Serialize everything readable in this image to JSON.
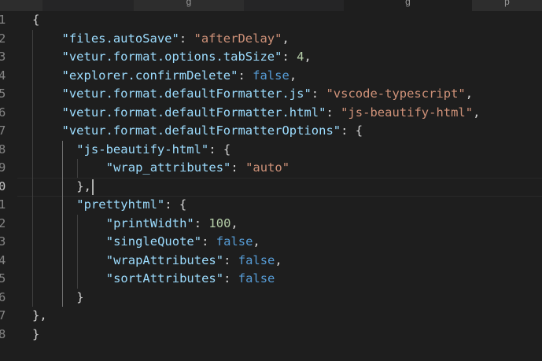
{
  "tabs": [
    {
      "label": "",
      "active": false
    },
    {
      "label": "g",
      "active": false
    },
    {
      "label": "g",
      "active": true
    },
    {
      "label": "p",
      "active": false
    }
  ],
  "gutter": {
    "line_numbers": [
      "1",
      "2",
      "3",
      "4",
      "5",
      "6",
      "7",
      "8",
      "9",
      "0",
      "1",
      "2",
      "3",
      "4",
      "5",
      "6",
      "7",
      "8"
    ],
    "active_line_index": 9
  },
  "code_lines": [
    {
      "indent": 0,
      "tokens": [
        {
          "t": "p",
          "v": "{"
        }
      ]
    },
    {
      "indent": 1,
      "tokens": [
        {
          "t": "k",
          "v": "\"files.autoSave\""
        },
        {
          "t": "p",
          "v": ": "
        },
        {
          "t": "s",
          "v": "\"afterDelay\""
        },
        {
          "t": "p",
          "v": ","
        }
      ]
    },
    {
      "indent": 1,
      "tokens": [
        {
          "t": "k",
          "v": "\"vetur.format.options.tabSize\""
        },
        {
          "t": "p",
          "v": ": "
        },
        {
          "t": "n",
          "v": "4"
        },
        {
          "t": "p",
          "v": ","
        }
      ]
    },
    {
      "indent": 1,
      "tokens": [
        {
          "t": "k",
          "v": "\"explorer.confirmDelete\""
        },
        {
          "t": "p",
          "v": ": "
        },
        {
          "t": "b",
          "v": "false"
        },
        {
          "t": "p",
          "v": ","
        }
      ]
    },
    {
      "indent": 1,
      "tokens": [
        {
          "t": "k",
          "v": "\"vetur.format.defaultFormatter.js\""
        },
        {
          "t": "p",
          "v": ": "
        },
        {
          "t": "s",
          "v": "\"vscode-typescript\""
        },
        {
          "t": "p",
          "v": ","
        }
      ]
    },
    {
      "indent": 1,
      "tokens": [
        {
          "t": "k",
          "v": "\"vetur.format.defaultFormatter.html\""
        },
        {
          "t": "p",
          "v": ": "
        },
        {
          "t": "s",
          "v": "\"js-beautify-html\""
        },
        {
          "t": "p",
          "v": ","
        }
      ]
    },
    {
      "indent": 1,
      "tokens": [
        {
          "t": "k",
          "v": "\"vetur.format.defaultFormatterOptions\""
        },
        {
          "t": "p",
          "v": ": {"
        }
      ]
    },
    {
      "indent": 1.5,
      "tokens": [
        {
          "t": "k",
          "v": "\"js-beautify-html\""
        },
        {
          "t": "p",
          "v": ": {"
        }
      ]
    },
    {
      "indent": 2.5,
      "tokens": [
        {
          "t": "k",
          "v": "\"wrap_attributes\""
        },
        {
          "t": "p",
          "v": ": "
        },
        {
          "t": "s",
          "v": "\"auto\""
        }
      ]
    },
    {
      "indent": 1.5,
      "tokens": [
        {
          "t": "p",
          "v": "},"
        }
      ]
    },
    {
      "indent": 1.5,
      "tokens": [
        {
          "t": "k",
          "v": "\"prettyhtml\""
        },
        {
          "t": "p",
          "v": ": {"
        }
      ]
    },
    {
      "indent": 2.5,
      "tokens": [
        {
          "t": "k",
          "v": "\"printWidth\""
        },
        {
          "t": "p",
          "v": ": "
        },
        {
          "t": "n",
          "v": "100"
        },
        {
          "t": "p",
          "v": ","
        }
      ]
    },
    {
      "indent": 2.5,
      "tokens": [
        {
          "t": "k",
          "v": "\"singleQuote\""
        },
        {
          "t": "p",
          "v": ": "
        },
        {
          "t": "b",
          "v": "false"
        },
        {
          "t": "p",
          "v": ","
        }
      ]
    },
    {
      "indent": 2.5,
      "tokens": [
        {
          "t": "k",
          "v": "\"wrapAttributes\""
        },
        {
          "t": "p",
          "v": ": "
        },
        {
          "t": "b",
          "v": "false"
        },
        {
          "t": "p",
          "v": ","
        }
      ]
    },
    {
      "indent": 2.5,
      "tokens": [
        {
          "t": "k",
          "v": "\"sortAttributes\""
        },
        {
          "t": "p",
          "v": ": "
        },
        {
          "t": "b",
          "v": "false"
        }
      ]
    },
    {
      "indent": 1.5,
      "tokens": [
        {
          "t": "p",
          "v": "}"
        }
      ]
    },
    {
      "indent": 0,
      "tokens": [
        {
          "t": "p",
          "v": "},"
        }
      ]
    },
    {
      "indent": 0,
      "tokens": [
        {
          "t": "p",
          "v": "}"
        }
      ]
    }
  ],
  "theme": {
    "background": "#1e1e1e",
    "key": "#9cdcfe",
    "string": "#ce9178",
    "number": "#b5cea8",
    "boolean": "#569cd6",
    "punctuation": "#d4d4d4",
    "line_number": "#858585"
  }
}
